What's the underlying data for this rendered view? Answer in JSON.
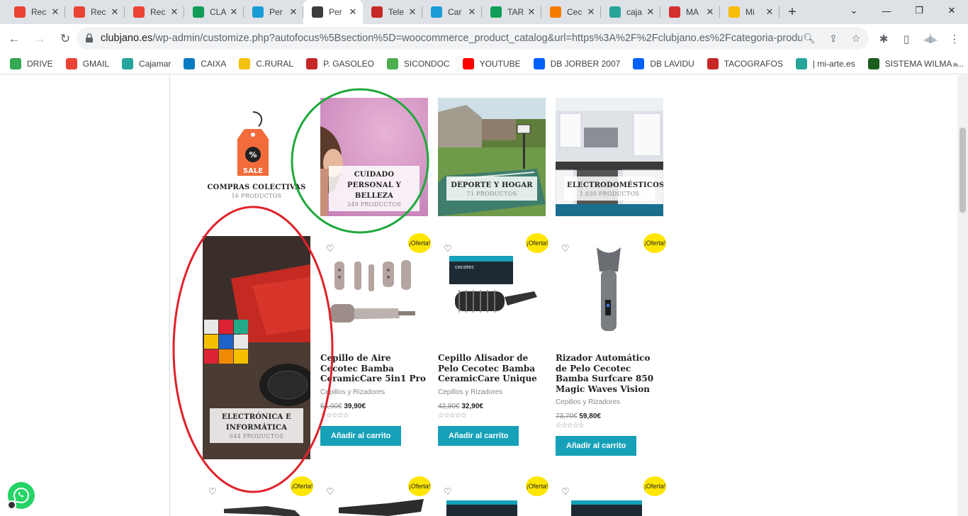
{
  "tabs": [
    {
      "label": "Rec",
      "icon": "gmail-icon",
      "color": "#ea4335"
    },
    {
      "label": "Rec",
      "icon": "gmail-icon",
      "color": "#ea4335"
    },
    {
      "label": "Rec",
      "icon": "gmail-icon",
      "color": "#ea4335"
    },
    {
      "label": "CLA",
      "icon": "sheets-icon",
      "color": "#0f9d58"
    },
    {
      "label": "Per",
      "icon": "globe-icon",
      "color": "#1a9bd7"
    },
    {
      "label": "Per",
      "icon": "site-icon",
      "color": "#3c3c3c"
    },
    {
      "label": "Tele",
      "icon": "site-icon",
      "color": "#c62828"
    },
    {
      "label": "Car",
      "icon": "globe-icon",
      "color": "#1a9bd7"
    },
    {
      "label": "TAR",
      "icon": "sheets-icon",
      "color": "#0f9d58"
    },
    {
      "label": "Cec",
      "icon": "box-icon",
      "color": "#f57c00"
    },
    {
      "label": "caja",
      "icon": "bank-icon",
      "color": "#26a69a"
    },
    {
      "label": "MA",
      "icon": "site-icon",
      "color": "#d32f2f"
    },
    {
      "label": "Mi",
      "icon": "drive-icon",
      "color": "#fbbc04"
    }
  ],
  "url": {
    "host": "clubjano.es",
    "rest": "/wp-admin/customize.php?autofocus%5Bsection%5D=woocommerce_product_catalog&url=https%3A%2F%2Fclubjano.es%2Fcategoria-producto..."
  },
  "bookmarks": [
    {
      "label": "DRIVE",
      "color": "#34a853"
    },
    {
      "label": "GMAIL",
      "color": "#ea4335"
    },
    {
      "label": "Cajamar",
      "color": "#26a69a"
    },
    {
      "label": "CAIXA",
      "color": "#0a7ac0"
    },
    {
      "label": "C.RURAL",
      "color": "#f4c20d"
    },
    {
      "label": "P. GASOLEO",
      "color": "#c62828"
    },
    {
      "label": "SICONDOC",
      "color": "#4caf50"
    },
    {
      "label": "YOUTUBE",
      "color": "#ff0000"
    },
    {
      "label": "DB JORBER 2007",
      "color": "#0061fe"
    },
    {
      "label": "DB LAVIDU",
      "color": "#0061fe"
    },
    {
      "label": "TACOGRAFOS",
      "color": "#c62828"
    },
    {
      "label": "| mi-arte.es",
      "color": "#26a69a"
    },
    {
      "label": "SISTEMA WILMA -...",
      "color": "#1b5e20"
    }
  ],
  "categories": [
    {
      "name": "COMPRAS COLECTIVAS",
      "count": "16 PRODUCTOS",
      "sale": "SALE"
    },
    {
      "name": "CUIDADO PERSONAL Y BELLEZA",
      "count": "249 PRODUCTOS"
    },
    {
      "name": "DEPORTE Y HOGAR",
      "count": "71 PRODUCTOS"
    },
    {
      "name": "ELECTRODOMÉSTICOS",
      "count": "1.030 PRODUCTOS"
    },
    {
      "name": "ELECTRÓNICA E INFORMÁTICA",
      "count": "644 PRODUCTOS"
    }
  ],
  "products": [
    {
      "title": "Cepillo de Aire Cecotec Bamba CeramicCare 5in1 Pro",
      "category": "Cepillos y Rizadores",
      "old_price": "54,90€",
      "price": "39,90€",
      "button": "Añadir al carrito",
      "badge": "¡Oferta!"
    },
    {
      "title": "Cepillo Alisador de Pelo Cecotec Bamba CeramicCare Unique",
      "category": "Cepillos y Rizadores",
      "old_price": "42,80€",
      "price": "32,90€",
      "button": "Añadir al carrito",
      "badge": "¡Oferta!",
      "brand": "cecotec"
    },
    {
      "title": "Rizador Automático de Pelo Cecotec Bamba Surfcare 850 Magic Waves Vision",
      "category": "Cepillos y Rizadores",
      "old_price": "73,70€",
      "price": "59,80€",
      "button": "Añadir al carrito",
      "badge": "¡Oferta!"
    }
  ],
  "row3_badge": "¡Oferta!",
  "annotation_colors": {
    "green": "#1fa83a",
    "red": "#e0222a"
  }
}
